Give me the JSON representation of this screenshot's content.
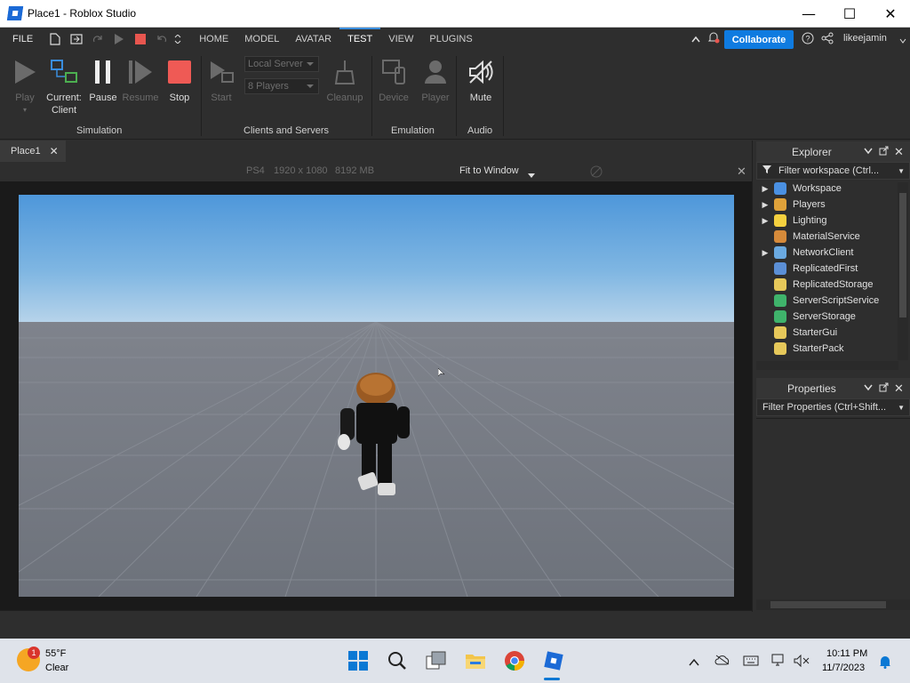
{
  "window": {
    "title": "Place1 - Roblox Studio",
    "minimize": "—",
    "maximize": "☐",
    "close": "✕"
  },
  "menubar": {
    "file": "FILE",
    "tabs": [
      "HOME",
      "MODEL",
      "AVATAR",
      "TEST",
      "VIEW",
      "PLUGINS"
    ],
    "active_tab": "TEST",
    "collaborate": "Collaborate",
    "username": "likeejamin"
  },
  "ribbon": {
    "simulation": {
      "label": "Simulation",
      "play": "Play",
      "current": "Current:",
      "client": "Client",
      "pause": "Pause",
      "resume": "Resume",
      "stop": "Stop"
    },
    "clients": {
      "label": "Clients and Servers",
      "start": "Start",
      "server_select": "Local Server",
      "players_select": "8 Players",
      "cleanup": "Cleanup"
    },
    "emulation": {
      "label": "Emulation",
      "device": "Device",
      "player": "Player"
    },
    "audio": {
      "label": "Audio",
      "mute": "Mute"
    }
  },
  "document": {
    "tab": "Place1",
    "close": "✕"
  },
  "viewport": {
    "device": "PS4",
    "resolution": "1920 x 1080",
    "memory": "8192 MB",
    "fit": "Fit to Window",
    "close": "✕"
  },
  "explorer": {
    "title": "Explorer",
    "filter_placeholder": "Filter workspace (Ctrl...",
    "items": [
      {
        "label": "Workspace",
        "expandable": true,
        "color": "#4a90e2"
      },
      {
        "label": "Players",
        "expandable": true,
        "color": "#e0a23a"
      },
      {
        "label": "Lighting",
        "expandable": true,
        "color": "#f4d03f"
      },
      {
        "label": "MaterialService",
        "expandable": false,
        "color": "#d68a3a"
      },
      {
        "label": "NetworkClient",
        "expandable": true,
        "color": "#6aa9e0"
      },
      {
        "label": "ReplicatedFirst",
        "expandable": false,
        "color": "#5b8fd6"
      },
      {
        "label": "ReplicatedStorage",
        "expandable": false,
        "color": "#e6c85a"
      },
      {
        "label": "ServerScriptService",
        "expandable": false,
        "color": "#3fb36b"
      },
      {
        "label": "ServerStorage",
        "expandable": false,
        "color": "#3fb36b"
      },
      {
        "label": "StarterGui",
        "expandable": false,
        "color": "#e6c85a"
      },
      {
        "label": "StarterPack",
        "expandable": false,
        "color": "#e6c85a"
      }
    ]
  },
  "properties": {
    "title": "Properties",
    "filter_placeholder": "Filter Properties (Ctrl+Shift..."
  },
  "taskbar": {
    "weather_badge": "1",
    "temperature": "55°F",
    "condition": "Clear",
    "time": "10:11 PM",
    "date": "11/7/2023"
  }
}
